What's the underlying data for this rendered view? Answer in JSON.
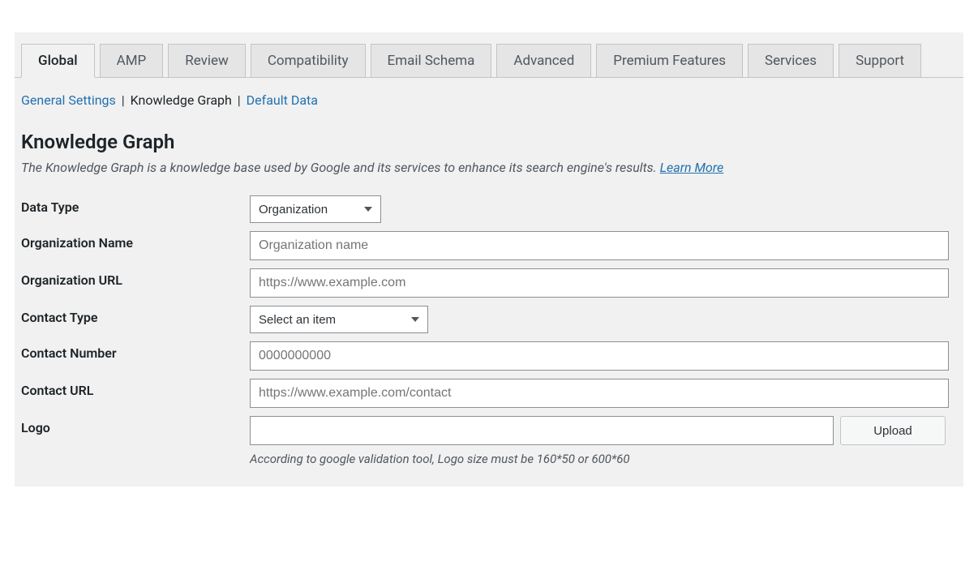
{
  "tabs": [
    {
      "label": "Global",
      "active": true
    },
    {
      "label": "AMP",
      "active": false
    },
    {
      "label": "Review",
      "active": false
    },
    {
      "label": "Compatibility",
      "active": false
    },
    {
      "label": "Email Schema",
      "active": false
    },
    {
      "label": "Advanced",
      "active": false
    },
    {
      "label": "Premium Features",
      "active": false
    },
    {
      "label": "Services",
      "active": false
    },
    {
      "label": "Support",
      "active": false
    }
  ],
  "subnav": {
    "items": [
      {
        "label": "General Settings",
        "current": false
      },
      {
        "label": "Knowledge Graph",
        "current": true
      },
      {
        "label": "Default Data",
        "current": false
      }
    ]
  },
  "section": {
    "title": "Knowledge Graph",
    "description": "The Knowledge Graph is a knowledge base used by Google and its services to enhance its search engine's results. ",
    "learn_more": "Learn More"
  },
  "fields": {
    "data_type": {
      "label": "Data Type",
      "selected": "Organization"
    },
    "org_name": {
      "label": "Organization Name",
      "placeholder": "Organization name",
      "value": ""
    },
    "org_url": {
      "label": "Organization URL",
      "placeholder": "https://www.example.com",
      "value": ""
    },
    "contact_type": {
      "label": "Contact Type",
      "selected": "Select an item"
    },
    "contact_number": {
      "label": "Contact Number",
      "placeholder": "0000000000",
      "value": ""
    },
    "contact_url": {
      "label": "Contact URL",
      "placeholder": "https://www.example.com/contact",
      "value": ""
    },
    "logo": {
      "label": "Logo",
      "value": "",
      "button": "Upload",
      "note": "According to google validation tool, Logo size must be 160*50 or 600*60"
    }
  }
}
